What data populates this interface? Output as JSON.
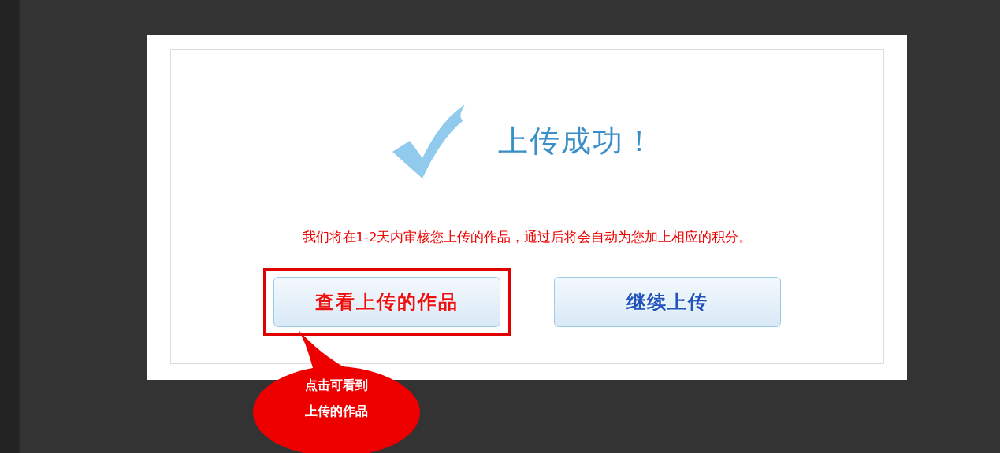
{
  "dialog": {
    "title": "上传成功！",
    "message": "我们将在1-2天内审核您上传的作品，通过后将会自动为您加上相应的积分。",
    "buttons": [
      {
        "label": "查看上传的作品",
        "color": "#ee1111",
        "highlighted": true
      },
      {
        "label": "继续上传",
        "color": "#2255bb",
        "highlighted": false
      }
    ]
  },
  "callout": {
    "lines": [
      "点击可看到",
      "上传的作品"
    ]
  }
}
